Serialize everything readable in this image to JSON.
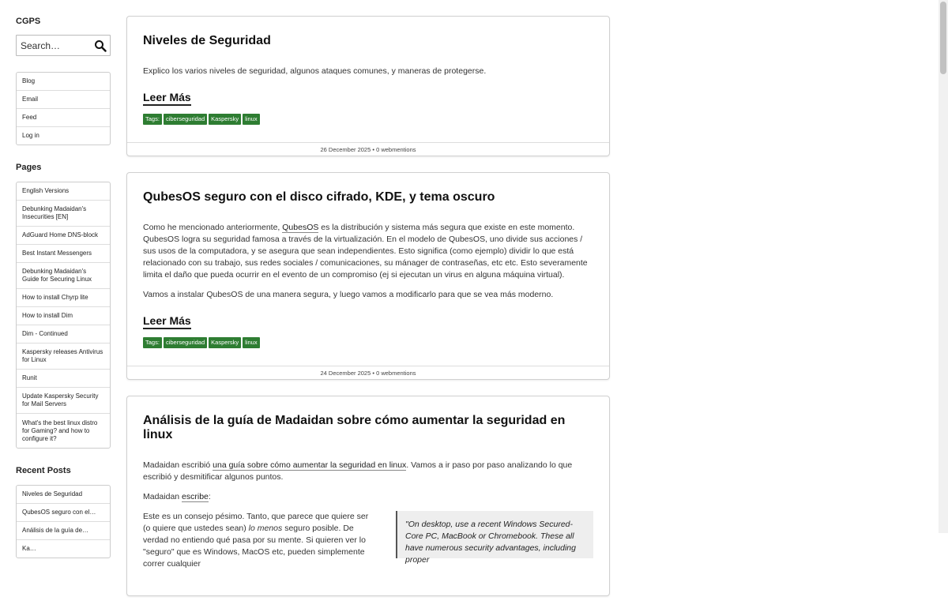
{
  "site": {
    "title": "CGPS"
  },
  "search": {
    "placeholder": "Search…"
  },
  "menu": [
    {
      "label": "Blog",
      "name": "menu-item-blog"
    },
    {
      "label": "Email",
      "name": "menu-item-email"
    },
    {
      "label": "Feed",
      "name": "menu-item-feed"
    },
    {
      "label": "Log in",
      "name": "menu-item-login"
    }
  ],
  "pages": {
    "heading": "Pages",
    "items": [
      "English Versions",
      "Debunking Madaidan's Insecurities [EN]",
      "AdGuard Home DNS-block",
      "Best Instant Messengers",
      "Debunking Madaidan's Guide for Securing Linux",
      "How to install Chyrp lite",
      "How to install Dim",
      "Dim - Continued",
      "Kaspersky releases Antivirus for Linux",
      "Runit",
      "Update Kaspersky Security for Mail Servers",
      "What's the best linux distro for Gaming? and how to configure it?"
    ]
  },
  "recent": {
    "heading": "Recent Posts",
    "items": [
      "Niveles de Seguridad",
      "QubesOS seguro con el…",
      "Análisis de la guía de…",
      "Ka…"
    ]
  },
  "posts": [
    {
      "title": "Niveles de Seguridad",
      "paragraphs": [
        {
          "text": "Explico los varios niveles de seguridad, algunos ataques comunes, y maneras de protegerse."
        }
      ],
      "read_more": "Leer Más",
      "tags_label": "Tags:",
      "tags": [
        "ciberseguridad",
        "Kaspersky",
        "linux"
      ],
      "footer": "26 December 2025 • 0 webmentions"
    },
    {
      "title": "QubesOS seguro con el disco cifrado, KDE, y tema oscuro",
      "p1_before": "Como he mencionado anteriormente, ",
      "p1_link": "QubesOS",
      "p1_after": " es la distribución y sistema más segura que existe en este momento. QubesOS logra su seguridad famosa a través de la virtualización. En el modelo de QubesOS, uno divide sus acciones / sus usos de la computadora, y se asegura que sean independientes. Esto significa (como ejemplo) dividir lo que está relacionado con su trabajo, sus redes sociales / comunicaciones, su mánager de contraseñas, etc etc. Esto severamente limita el daño que pueda ocurrir en el evento de un compromiso (ej si ejecutan un virus en alguna máquina virtual).",
      "p2": "Vamos a instalar QubesOS de una manera segura, y luego vamos a modificarlo para que se vea más moderno.",
      "read_more": "Leer Más",
      "tags_label": "Tags:",
      "tags": [
        "ciberseguridad",
        "Kaspersky",
        "linux"
      ],
      "footer": "24 December 2025 • 0 webmentions"
    },
    {
      "title": "Análisis de la guía de Madaidan sobre cómo aumentar la seguridad en linux",
      "p1_before": "Madaidan escribió ",
      "p1_link": "una guía sobre cómo aumentar la seguridad en linux",
      "p1_after": ". Vamos a ir paso por paso analizando lo que escribió y desmitificar algunos puntos.",
      "p2_before": "Madaidan ",
      "p2_link": "escribe",
      "p2_after": ":",
      "quote": "\"On desktop, use a recent Windows Secured-Core PC, MacBook or Chromebook. These all have numerous security advantages, including proper",
      "p3_a": "Este es un consejo pésimo. Tanto, que parece que quiere ser (o quiere que ustedes sean) ",
      "p3_em": "lo menos",
      "p3_b": " seguro posible. De verdad no entiendo qué pasa por su mente. Si quieren ver lo \"seguro\" que es Windows, MacOS etc, pueden simplemente correr cualquier"
    }
  ],
  "colors": {
    "tag_bg": "#2e7d32",
    "quote_bg": "#eeeeee"
  }
}
